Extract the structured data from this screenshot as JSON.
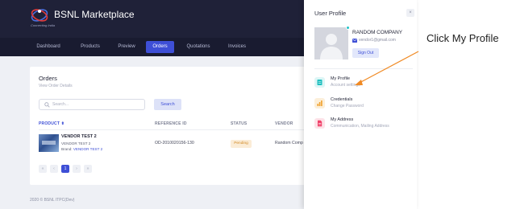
{
  "brand": {
    "name": "BSNL Marketplace",
    "tagline": "Connecting India"
  },
  "nav": {
    "items": [
      {
        "label": "Dashboard",
        "active": false
      },
      {
        "label": "Products",
        "active": false
      },
      {
        "label": "Preview",
        "active": false
      },
      {
        "label": "Orders",
        "active": true
      },
      {
        "label": "Quotations",
        "active": false
      },
      {
        "label": "Invoices",
        "active": false
      }
    ]
  },
  "orders": {
    "title": "Orders",
    "subtitle": "View Order Details",
    "search_placeholder": "Search...",
    "search_button": "Search",
    "columns": [
      "PRODUCT ⬍",
      "REFERENCE ID",
      "STATUS",
      "VENDOR"
    ],
    "rows": [
      {
        "product_name": "VENDOR TEST 2",
        "product_vendor": "VENDOR TEST 2",
        "brand_label": "Brand:",
        "brand_value": "VENDOR TEST 2",
        "reference_id": "OD-2010020156-130",
        "status": "Pending",
        "vendor": "Random Comp"
      }
    ],
    "pagination": {
      "first": "«",
      "prev": "‹",
      "current": "1",
      "next": "›",
      "last": "»"
    }
  },
  "footer": {
    "text": "2020 ©  BSNL ITPC(Dev)"
  },
  "profile_panel": {
    "title": "User Profile",
    "close": "×",
    "company": "RANDOM COMPANY",
    "email": "vendor1@gmail.com",
    "sign_out": "Sign Out",
    "menu": [
      {
        "title": "My Profile",
        "subtitle": "Account settings",
        "icon": "profile-card-icon",
        "color": "#1fbfbf",
        "bg": "#ddf6f6"
      },
      {
        "title": "Credentials",
        "subtitle": "Change Password",
        "icon": "chart-icon",
        "color": "#f0a02b",
        "bg": "#fcefd9"
      },
      {
        "title": "My Address",
        "subtitle": "Communication, Mailing Address",
        "icon": "document-icon",
        "color": "#f0426a",
        "bg": "#fde2e8"
      }
    ]
  },
  "annotation": {
    "text": "Click My Profile",
    "arrow_color": "#f08a24"
  },
  "colors": {
    "header": "#1f2138",
    "accent": "#3e4fd6",
    "pending": "#d08a25"
  }
}
